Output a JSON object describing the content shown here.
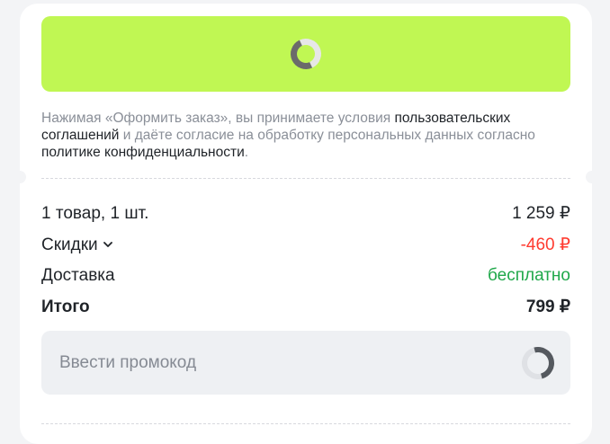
{
  "checkout_button": {
    "state": "loading",
    "color": "#c0f753"
  },
  "consent": {
    "text_1": "Нажимая «Оформить заказ», вы принимаете условия ",
    "link_terms": "пользовательских соглашений",
    "text_2": " и даёте согласие на обработку персональных данных согласно ",
    "link_privacy": "политике конфиденциальности",
    "text_3": "."
  },
  "summary": {
    "items_label": "1 товар, 1 шт.",
    "items_value": "1 259 ₽",
    "discount_label": "Скидки",
    "discount_value": "-460 ₽",
    "delivery_label": "Доставка",
    "delivery_value": "бесплатно",
    "total_label": "Итого",
    "total_value": "799 ₽"
  },
  "colors": {
    "discount": "#ff3b30",
    "delivery": "#1fa84a"
  },
  "promo": {
    "placeholder": "Ввести промокод",
    "state": "loading"
  }
}
